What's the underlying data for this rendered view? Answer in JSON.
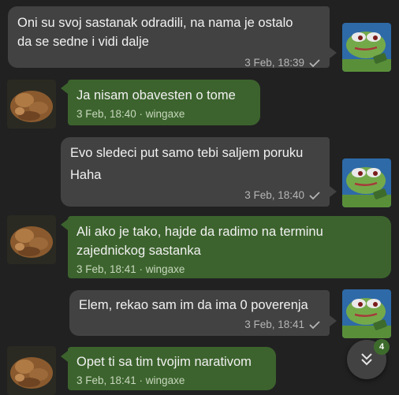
{
  "colors": {
    "background": "#212121",
    "incoming_bubble": "#3c632d",
    "outgoing_bubble": "#424242",
    "badge": "#3d6b2c"
  },
  "messages": [
    {
      "direction": "outgoing",
      "lines": [
        "Oni su svoj sastanak odradili, na nama je ostalo",
        "da se sedne i vidi dalje"
      ],
      "meta": "3 Feb, 18:39",
      "status_icon": "single-check-icon"
    },
    {
      "direction": "incoming",
      "lines": [
        "Ja nisam obavesten o tome"
      ],
      "meta": "3 Feb, 18:40 · wingaxe"
    },
    {
      "direction": "outgoing",
      "lines": [
        "Evo sledeci put samo tebi saljem poruku",
        "Haha"
      ],
      "meta": "3 Feb, 18:40",
      "status_icon": "single-check-icon"
    },
    {
      "direction": "incoming",
      "lines": [
        "Ali ako je tako, hajde da radimo na terminu",
        "zajednickog sastanka"
      ],
      "meta": "3 Feb, 18:41 · wingaxe"
    },
    {
      "direction": "outgoing",
      "lines": [
        "Elem, rekao sam im da ima 0 poverenja"
      ],
      "meta": "3 Feb, 18:41",
      "status_icon": "single-check-icon"
    },
    {
      "direction": "incoming",
      "lines": [
        "Opet ti sa tim tvojim narativom"
      ],
      "meta": "3 Feb, 18:41 · wingaxe"
    }
  ],
  "scroll_down": {
    "icon": "double-chevron-down-icon",
    "unread_count": "4"
  }
}
